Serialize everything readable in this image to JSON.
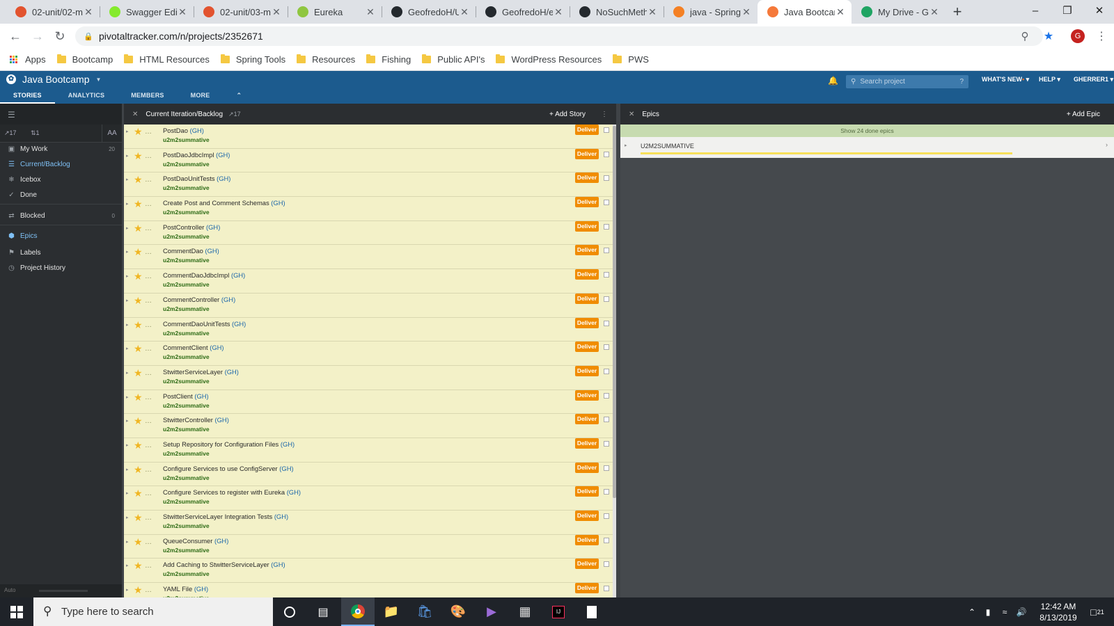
{
  "browser": {
    "tabs": [
      {
        "title": "02-unit/02-m",
        "icon_color": "#e2532f"
      },
      {
        "title": "Swagger Edit",
        "icon_color": "#85ea2d"
      },
      {
        "title": "02-unit/03-m",
        "icon_color": "#e2532f"
      },
      {
        "title": "Eureka",
        "icon_color": "#8fc640"
      },
      {
        "title": "GeofredoH/U",
        "icon_color": "#24292e"
      },
      {
        "title": "GeofredoH/e",
        "icon_color": "#24292e"
      },
      {
        "title": "NoSuchMeth",
        "icon_color": "#24292e"
      },
      {
        "title": "java - Spring",
        "icon_color": "#f48024"
      },
      {
        "title": "Java Bootcam",
        "icon_color": "#f5793a",
        "active": true
      },
      {
        "title": "My Drive - Go",
        "icon_color": "#1fa463"
      }
    ],
    "url": "pivotaltracker.com/n/projects/2352671",
    "profile_initial": "G",
    "bookmarks": [
      "Apps",
      "Bootcamp",
      "HTML Resources",
      "Spring Tools",
      "Resources",
      "Fishing",
      "Public API's",
      "WordPress Resources",
      "PWS"
    ]
  },
  "tracker": {
    "project_name": "Java Bootcamp",
    "nav_tabs": [
      "STORIES",
      "ANALYTICS",
      "MEMBERS",
      "MORE"
    ],
    "search_placeholder": "Search project",
    "search_help": "?",
    "whats_new": "WHAT'S NEW",
    "help": "HELP",
    "user": "GHERRER1"
  },
  "sidebar": {
    "velocity": "17",
    "members_count": "1",
    "font_toggle": "AA",
    "items": [
      {
        "label": "My Work",
        "icon": "work-icon",
        "count": "20"
      },
      {
        "label": "Current/Backlog",
        "icon": "list-icon",
        "active": true
      },
      {
        "label": "Icebox",
        "icon": "snowflake-icon"
      },
      {
        "label": "Done",
        "icon": "check-icon"
      },
      {
        "label": "Blocked",
        "icon": "blocked-icon",
        "count": "0"
      },
      {
        "label": "Epics",
        "icon": "epic-icon",
        "active": true
      },
      {
        "label": "Labels",
        "icon": "tag-icon"
      },
      {
        "label": "Project History",
        "icon": "history-icon"
      }
    ],
    "footer": "Auto"
  },
  "backlog": {
    "title": "Current Iteration/Backlog",
    "velocity": "17",
    "add_story": "Add Story",
    "stories": [
      {
        "title": "PostDao",
        "label": "u2m2summative"
      },
      {
        "title": "PostDaoJdbcImpl",
        "label": "u2m2summative"
      },
      {
        "title": "PostDaoUnitTests",
        "label": "u2m2summative"
      },
      {
        "title": "Create Post and Comment Schemas",
        "label": "u2m2summative"
      },
      {
        "title": "PostController",
        "label": "u2m2summative"
      },
      {
        "title": "CommentDao",
        "label": "u2m2summative"
      },
      {
        "title": "CommentDaoJdbcImpl",
        "label": "u2m2summative"
      },
      {
        "title": "CommentController",
        "label": "u2m2summative"
      },
      {
        "title": "CommentDaoUnitTests",
        "label": "u2m2summative"
      },
      {
        "title": "CommentClient",
        "label": "u2m2summative"
      },
      {
        "title": "StwitterServiceLayer",
        "label": "u2m2summative"
      },
      {
        "title": "PostClient",
        "label": "u2m2summative"
      },
      {
        "title": "StwitterController",
        "label": "u2m2summative"
      },
      {
        "title": "Setup Repository for Configuration Files",
        "label": "u2m2summative"
      },
      {
        "title": "Configure Services to use ConfigServer",
        "label": "u2m2summative"
      },
      {
        "title": "Configure Services to register with Eureka",
        "label": "u2m2summative"
      },
      {
        "title": "StwitterServiceLayer Integration Tests",
        "label": "u2m2summative"
      },
      {
        "title": "QueueConsumer",
        "label": "u2m2summative"
      },
      {
        "title": "Add Caching to StwitterServiceLayer",
        "label": "u2m2summative"
      },
      {
        "title": "YAML File",
        "label": "u2m2summative"
      }
    ],
    "gh": "(GH)",
    "deliver": "Deliver"
  },
  "epics": {
    "title": "Epics",
    "add_epic": "Add Epic",
    "show_done": "Show 24 done epics",
    "items": [
      {
        "name": "U2M2SUMMATIVE"
      }
    ]
  },
  "taskbar": {
    "search_placeholder": "Type here to search",
    "time": "12:42 AM",
    "date": "8/13/2019",
    "notifications": "21"
  },
  "colors": {
    "tracker_blue": "#1c5b8e",
    "deliver_orange": "#f08c00",
    "story_bg": "#f3f1c8",
    "star": "#f0b623"
  }
}
